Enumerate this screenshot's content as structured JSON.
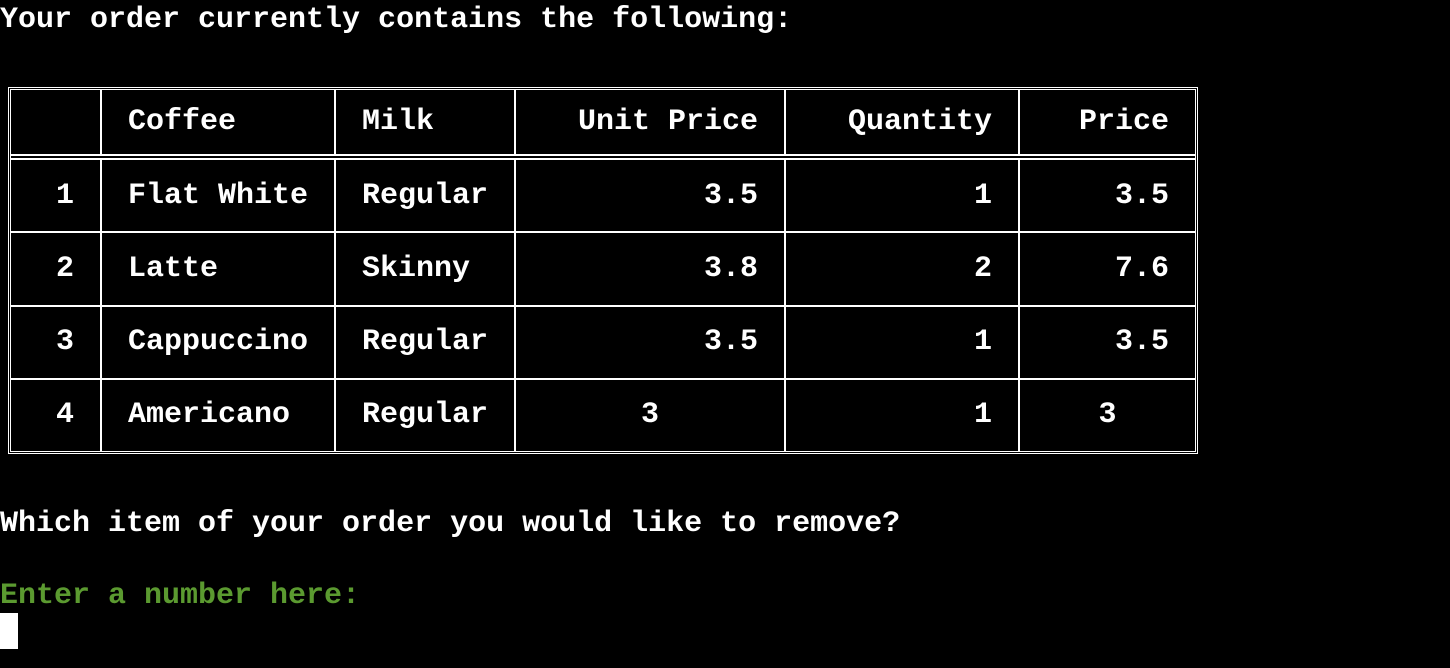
{
  "terminal": {
    "intro": "Your order currently contains the following:",
    "question": "Which item of your order you would like to remove?",
    "prompt": "Enter a number here:",
    "prompt_color": "#5b9a30",
    "background": "#000000",
    "foreground": "#ffffff"
  },
  "order_table": {
    "headers": [
      "",
      "Coffee",
      "Milk",
      "Unit Price",
      "Quantity",
      "Price"
    ],
    "rows": [
      [
        "1",
        "Flat White",
        "Regular",
        "3.5",
        "1",
        "3.5"
      ],
      [
        "2",
        "Latte",
        "Skinny",
        "3.8",
        "2",
        "7.6"
      ],
      [
        "3",
        "Cappuccino",
        "Regular",
        "3.5",
        "1",
        "3.5"
      ],
      [
        "4",
        "Americano",
        "Regular",
        "3",
        "1",
        "3"
      ]
    ]
  }
}
